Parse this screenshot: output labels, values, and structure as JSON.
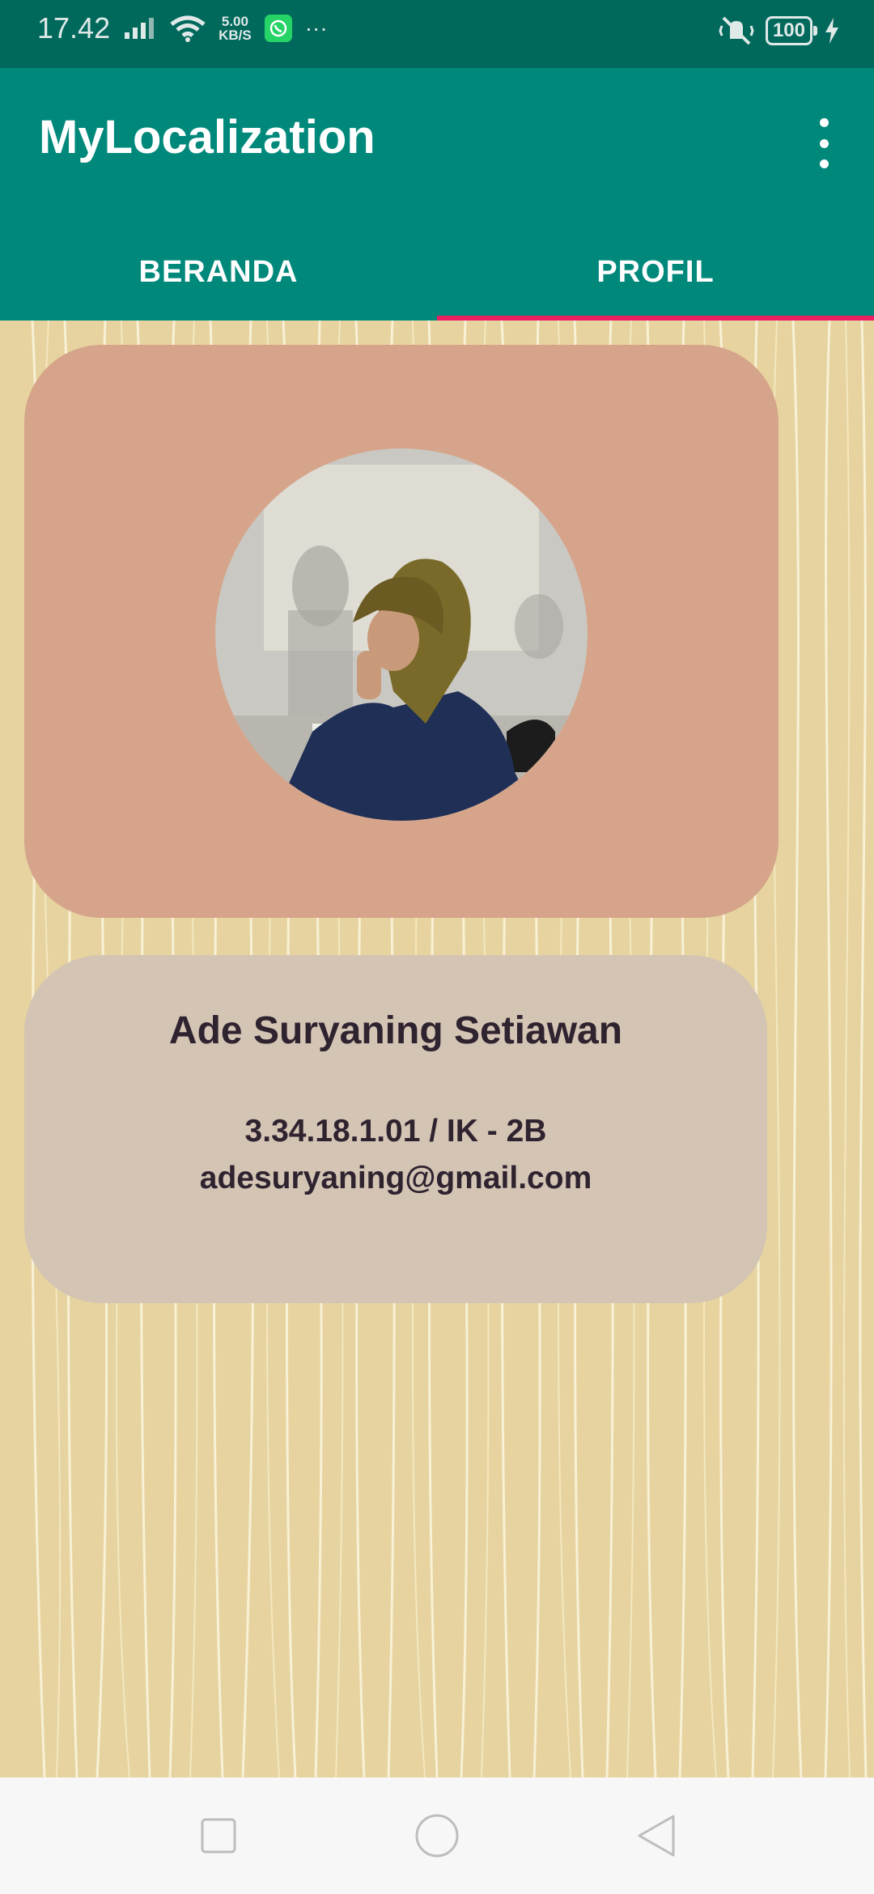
{
  "status_bar": {
    "time": "17.42",
    "net_speed_value": "5.00",
    "net_speed_unit": "KB/S",
    "more": "···",
    "battery": "100"
  },
  "app_bar": {
    "title": "MyLocalization",
    "tabs": [
      {
        "label": "BERANDA",
        "active": false
      },
      {
        "label": "PROFIL",
        "active": true
      }
    ],
    "indicator_color": "#e91e63"
  },
  "profile": {
    "name": "Ade Suryaning Setiawan",
    "nim_class": "3.34.18.1.01 / IK - 2B",
    "email": "adesuryaning@gmail.com"
  },
  "colors": {
    "primary": "#00897b",
    "primary_dark": "#00695c",
    "photo_card": "#d6a48a",
    "info_card": "#d3c4b4"
  },
  "nav_bar": {
    "icons": [
      "recent-apps-icon",
      "home-icon",
      "back-icon"
    ]
  }
}
